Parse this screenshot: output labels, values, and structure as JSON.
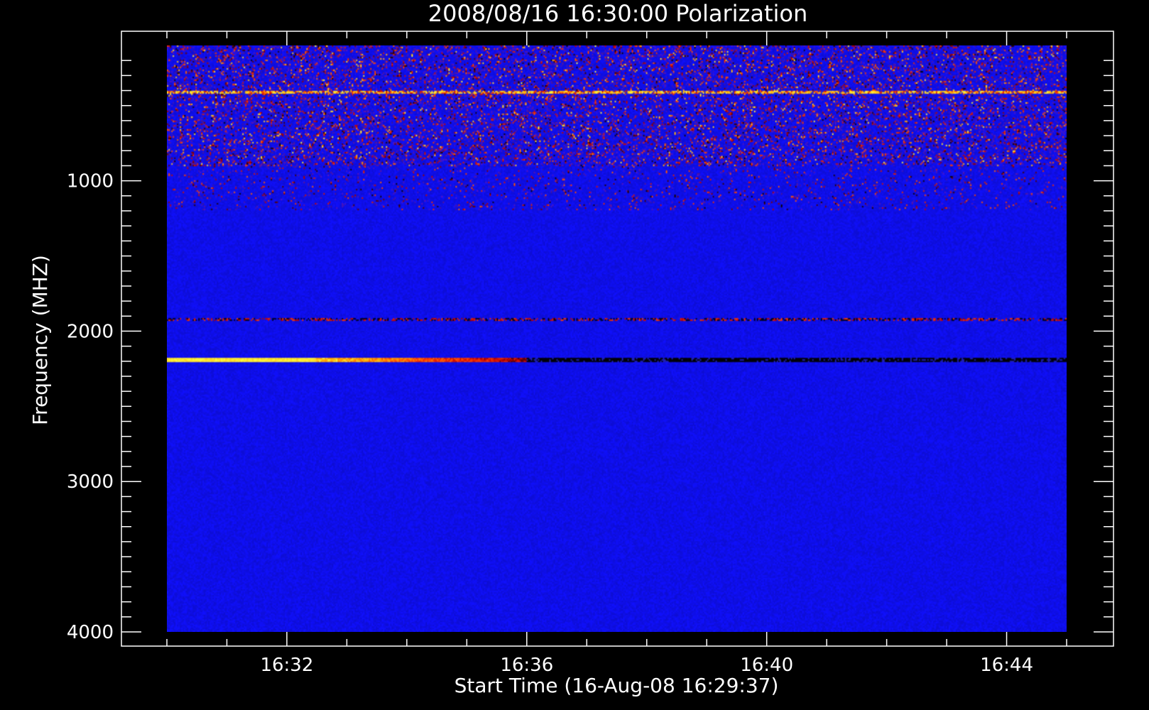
{
  "chart_data": {
    "type": "heatmap",
    "title": "2008/08/16 16:30:00 Polarization",
    "xlabel": "Start Time (16-Aug-08 16:29:37)",
    "ylabel": "Frequency (MHZ)",
    "x_tick_labels": [
      "16:32",
      "16:36",
      "16:40",
      "16:44"
    ],
    "x_ticks_minutes": [
      2,
      6,
      10,
      14
    ],
    "x_range_minutes": [
      0,
      15
    ],
    "y_tick_labels": [
      "1000",
      "2000",
      "3000",
      "4000"
    ],
    "y_ticks": [
      1000,
      2000,
      3000,
      4000
    ],
    "y_range": [
      100,
      4000
    ],
    "y_inverted": true,
    "colormap": [
      "#000000",
      "#c00000",
      "#ff4000",
      "#ffa000",
      "#ffff40"
    ],
    "background_color": "#1010ff",
    "features": [
      {
        "name": "top noise band",
        "freq_range": [
          100,
          1200
        ],
        "minute_range": [
          0,
          15
        ],
        "intensity": "mixed"
      },
      {
        "name": "bright line",
        "freq": 410,
        "minute_range": [
          0,
          15
        ],
        "intensity": "high"
      },
      {
        "name": "line",
        "freq": 1920,
        "minute_range": [
          0,
          15
        ],
        "intensity": "mixed"
      },
      {
        "name": "strong emission line",
        "freq": 2190,
        "minute_range": [
          0,
          6
        ],
        "intensity": "high-fading"
      },
      {
        "name": "dark line",
        "freq": 2190,
        "minute_range": [
          6,
          15
        ],
        "intensity": "low"
      }
    ]
  }
}
